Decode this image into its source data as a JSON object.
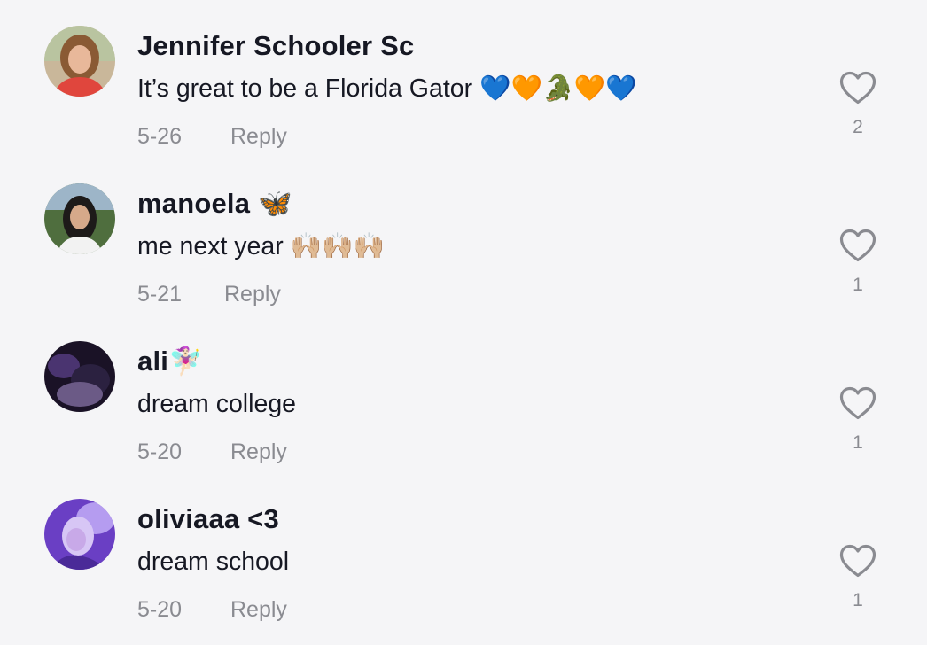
{
  "comments": [
    {
      "username": "Jennifer Schooler Sc",
      "text": "It’s great to be a Florida Gator 💙🧡🐊🧡💙",
      "date": "5-26",
      "reply_label": "Reply",
      "likes": "2"
    },
    {
      "username": "manoela 🦋",
      "text": "me next year 🙌🏼🙌🏼🙌🏼",
      "date": "5-21",
      "reply_label": "Reply",
      "likes": "1"
    },
    {
      "username": "ali🧚🏻‍♀️",
      "text": "dream college",
      "date": "5-20",
      "reply_label": "Reply",
      "likes": "1"
    },
    {
      "username": "oliviaaa <3",
      "text": "dream school",
      "date": "5-20",
      "reply_label": "Reply",
      "likes": "1"
    }
  ],
  "colors": {
    "background": "#f5f5f7",
    "username": "#161823",
    "meta": "#8a8b91",
    "heart_outline": "#8a8b91"
  },
  "icons": {
    "like": "heart-outline-icon"
  }
}
